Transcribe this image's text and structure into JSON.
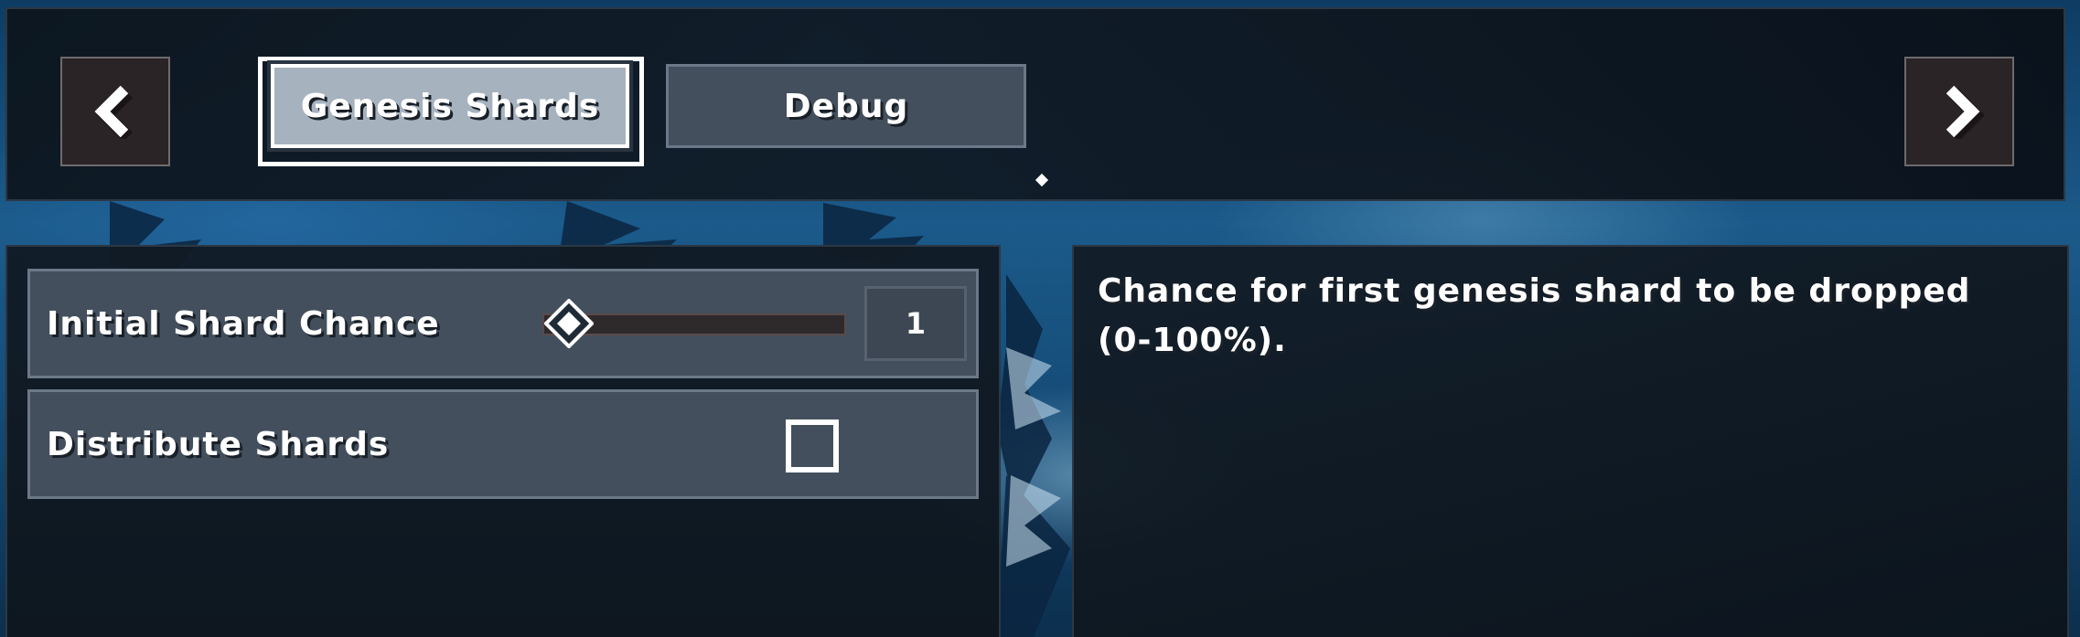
{
  "tabs": [
    {
      "label": "Genesis Shards",
      "active": true
    },
    {
      "label": "Debug",
      "active": false
    }
  ],
  "nav": {
    "prev_icon": "chevron-left-icon",
    "next_icon": "chevron-right-icon"
  },
  "settings": {
    "initial_shard_chance": {
      "label": "Initial Shard Chance",
      "value": "1",
      "min": 0,
      "max": 100,
      "slider_value": 1
    },
    "distribute_shards": {
      "label": "Distribute Shards",
      "checked": false
    }
  },
  "description": {
    "text": "Chance for first genesis shard to be dropped (0-100%)."
  },
  "colors": {
    "panel_bg": "#101a24",
    "row_bg": "#434f5c",
    "active_tab_bg": "#a6b2be",
    "arrow_button_bg": "#2a2426"
  }
}
